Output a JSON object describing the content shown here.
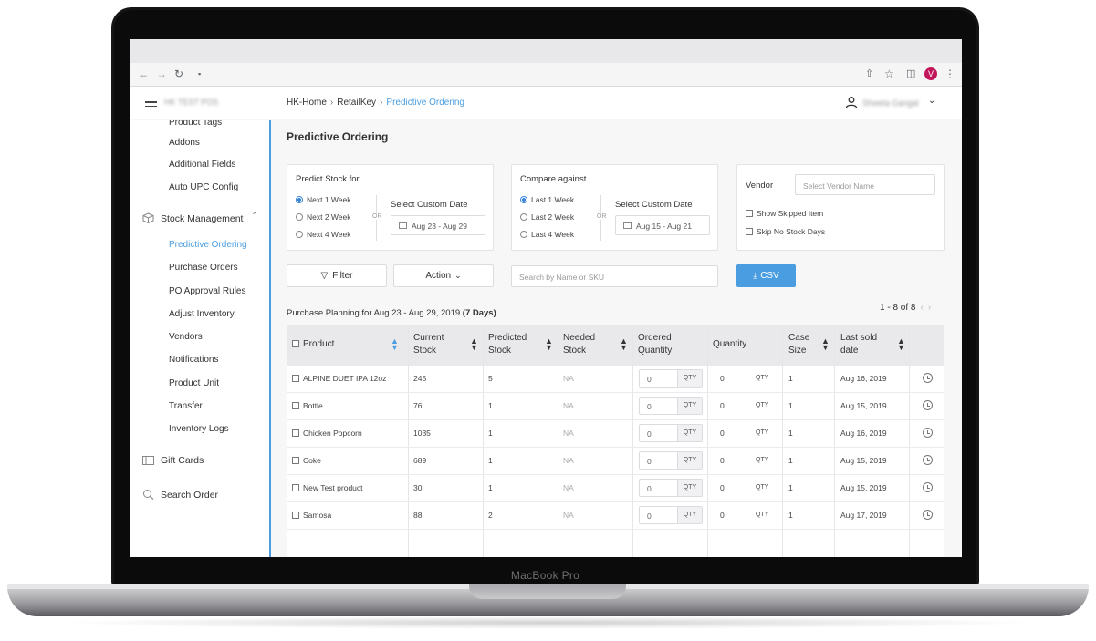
{
  "device": {
    "brand": "MacBook Pro"
  },
  "browser": {
    "profile_initial": "V"
  },
  "header": {
    "store_name": "HK TEST POS",
    "breadcrumb": [
      "HK-Home",
      "RetailKey",
      "Predictive Ordering"
    ],
    "user_name": "Shweta Gangal"
  },
  "sidebar": {
    "items": [
      {
        "label": "Product Tags",
        "level": "sub"
      },
      {
        "label": "Addons",
        "level": "sub"
      },
      {
        "label": "Additional Fields",
        "level": "sub"
      },
      {
        "label": "Auto UPC Config",
        "level": "sub"
      },
      {
        "label": "Stock Management",
        "level": "main",
        "icon": "cube-icon",
        "expanded": true
      },
      {
        "label": "Predictive Ordering",
        "level": "sub",
        "active": true
      },
      {
        "label": "Purchase Orders",
        "level": "sub"
      },
      {
        "label": "PO Approval Rules",
        "level": "sub"
      },
      {
        "label": "Adjust Inventory",
        "level": "sub"
      },
      {
        "label": "Vendors",
        "level": "sub"
      },
      {
        "label": "Notifications",
        "level": "sub"
      },
      {
        "label": "Product Unit",
        "level": "sub"
      },
      {
        "label": "Transfer",
        "level": "sub"
      },
      {
        "label": "Inventory Logs",
        "level": "sub"
      },
      {
        "label": "Gift Cards",
        "level": "main",
        "icon": "gift-card-icon"
      },
      {
        "label": "Search Order",
        "level": "main",
        "icon": "search-order-icon"
      }
    ]
  },
  "page": {
    "title": "Predictive Ordering"
  },
  "predict": {
    "title": "Predict Stock for",
    "options": [
      "Next 1 Week",
      "Next 2 Week",
      "Next 4 Week"
    ],
    "selected": "Next 1 Week",
    "or": "OR",
    "custom_label": "Select Custom Date",
    "date_range": "Aug 23 - Aug 29"
  },
  "compare": {
    "title": "Compare against",
    "options": [
      "Last 1 Week",
      "Last 2 Week",
      "Last 4 Week"
    ],
    "selected": "Last 1 Week",
    "or": "OR",
    "custom_label": "Select Custom Date",
    "date_range": "Aug 15 - Aug 21"
  },
  "vendor": {
    "label": "Vendor",
    "placeholder": "Select Vendor Name",
    "show_skipped": "Show Skipped Item",
    "skip_no_stock": "Skip No Stock Days"
  },
  "toolbar": {
    "filter": "Filter",
    "action": "Action",
    "search_placeholder": "Search by Name or SKU",
    "csv": "CSV"
  },
  "planning": {
    "text": "Purchase Planning for Aug 23 - Aug 29, 2019",
    "days": "(7 Days)",
    "pagination": "1 - 8 of 8"
  },
  "table": {
    "columns": [
      {
        "key": "product",
        "label": "Product"
      },
      {
        "key": "current_stock",
        "label": "Current Stock"
      },
      {
        "key": "predicted_stock",
        "label": "Predicted Stock"
      },
      {
        "key": "needed_stock",
        "label": "Needed Stock"
      },
      {
        "key": "ordered_quantity",
        "label": "Ordered Quantity"
      },
      {
        "key": "quantity",
        "label": "Quantity"
      },
      {
        "key": "case_size",
        "label": "Case Size"
      },
      {
        "key": "last_sold",
        "label": "Last sold date"
      }
    ],
    "qty_unit": "QTY",
    "rows": [
      {
        "product": "ALPINE DUET IPA 12oz",
        "current": "245",
        "predicted": "5",
        "needed": "NA",
        "ordered": "0",
        "quantity": "0",
        "case": "1",
        "last_sold": "Aug 16, 2019"
      },
      {
        "product": "Bottle",
        "current": "76",
        "predicted": "1",
        "needed": "NA",
        "ordered": "0",
        "quantity": "0",
        "case": "1",
        "last_sold": "Aug 15, 2019"
      },
      {
        "product": "Chicken Popcorn",
        "current": "1035",
        "predicted": "1",
        "needed": "NA",
        "ordered": "0",
        "quantity": "0",
        "case": "1",
        "last_sold": "Aug 16, 2019"
      },
      {
        "product": "Coke",
        "current": "689",
        "predicted": "1",
        "needed": "NA",
        "ordered": "0",
        "quantity": "0",
        "case": "1",
        "last_sold": "Aug 15, 2019"
      },
      {
        "product": "New Test product",
        "current": "30",
        "predicted": "1",
        "needed": "NA",
        "ordered": "0",
        "quantity": "0",
        "case": "1",
        "last_sold": "Aug 15, 2019"
      },
      {
        "product": "Samosa",
        "current": "88",
        "predicted": "2",
        "needed": "NA",
        "ordered": "0",
        "quantity": "0",
        "case": "1",
        "last_sold": "Aug 17, 2019"
      }
    ]
  },
  "colors": {
    "accent": "#4a9de0",
    "header_bg": "#e9e9eb",
    "bezel": "#151516"
  }
}
